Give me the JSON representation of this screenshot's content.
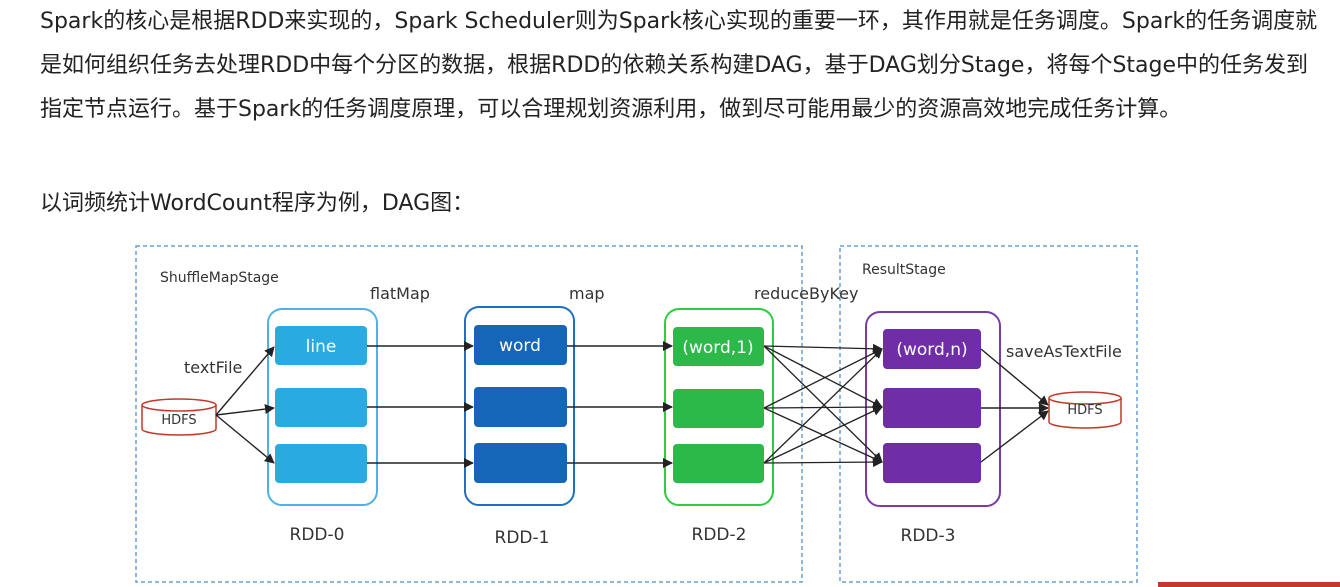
{
  "article": {
    "paragraph1": "Spark的核心是根据RDD来实现的，Spark Scheduler则为Spark核心实现的重要一环，其作用就是任务调度。Spark的任务调度就是如何组织任务去处理RDD中每个分区的数据，根据RDD的依赖关系构建DAG，基于DAG划分Stage，将每个Stage中的任务发到指定节点运行。基于Spark的任务调度原理，可以合理规划资源利用，做到尽可能用最少的资源高效地完成任务计算。",
    "paragraph2": "以词频统计WordCount程序为例，DAG图："
  },
  "diagram": {
    "stage_shuffle": "ShuffleMapStage",
    "stage_result": "ResultStage",
    "op_textfile": "textFile",
    "op_flatmap": "flatMap",
    "op_map": "map",
    "op_reducebykey": "reduceByKey",
    "op_save": "saveAsTextFile",
    "hdfs_in": "HDFS",
    "hdfs_out": "HDFS",
    "rdd0_label": "RDD-0",
    "rdd1_label": "RDD-1",
    "rdd2_label": "RDD-2",
    "rdd3_label": "RDD-3",
    "rdd0_first": "line",
    "rdd1_first": "word",
    "rdd2_first": "(word,1)",
    "rdd3_first": "(word,n)",
    "colors": {
      "rdd0_border": "#4db3e6",
      "rdd0_cell": "#29abe2",
      "rdd1_border": "#1f6fc0",
      "rdd1_cell": "#1565b8",
      "rdd2_border": "#2ecc40",
      "rdd2_cell": "#2db84a",
      "rdd3_border": "#7b3aa6",
      "rdd3_cell": "#6f2da8",
      "hdfs": "#c0392b",
      "stage_border": "#6a9ed0"
    }
  }
}
